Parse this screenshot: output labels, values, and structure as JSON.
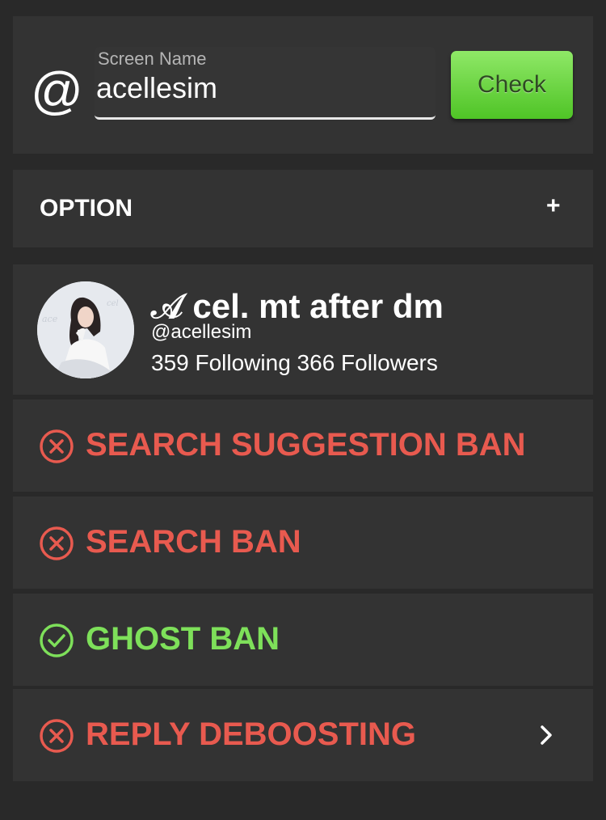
{
  "search": {
    "at_symbol": "@",
    "field_label": "Screen Name",
    "value": "acellesim",
    "button_label": "Check"
  },
  "option": {
    "title": "OPTION",
    "toggle": "+"
  },
  "profile": {
    "display_name": "𝒜 cel. mt after dm",
    "handle": "@acellesim",
    "stats": "359 Following 366 Followers"
  },
  "results": [
    {
      "label": "SEARCH SUGGESTION BAN",
      "status": "banned",
      "icon": "x-circle-icon"
    },
    {
      "label": "SEARCH BAN",
      "status": "banned",
      "icon": "x-circle-icon"
    },
    {
      "label": "GHOST BAN",
      "status": "ok",
      "icon": "check-circle-icon"
    },
    {
      "label": "REPLY DEBOOSTING",
      "status": "banned",
      "icon": "x-circle-icon"
    }
  ],
  "colors": {
    "background": "#292929",
    "card": "#333333",
    "banned": "#e85a4f",
    "ok": "#7ee05a",
    "button": "#6fd846"
  }
}
